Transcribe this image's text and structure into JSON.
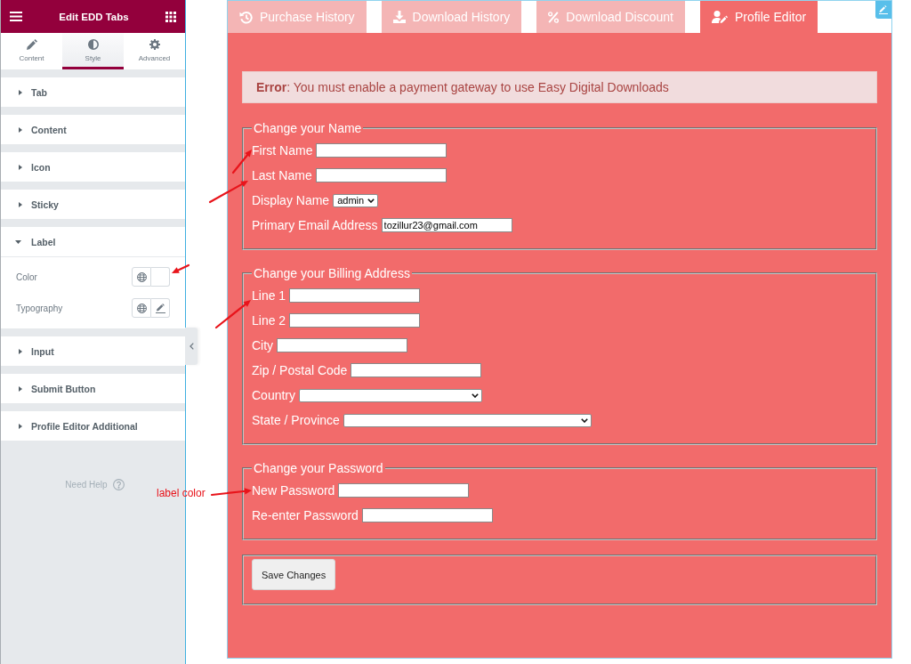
{
  "editor_panel": {
    "title": "Edit EDD Tabs",
    "tabs": [
      {
        "label": "Content",
        "selected": false
      },
      {
        "label": "Style",
        "selected": true
      },
      {
        "label": "Advanced",
        "selected": false
      }
    ],
    "sections": [
      {
        "title": "Tab",
        "expanded": false
      },
      {
        "title": "Content",
        "expanded": false
      },
      {
        "title": "Icon",
        "expanded": false
      },
      {
        "title": "Sticky",
        "expanded": false
      },
      {
        "title": "Label",
        "expanded": true,
        "controls": [
          {
            "label": "Color",
            "kind": "color"
          },
          {
            "label": "Typography",
            "kind": "typography"
          }
        ]
      },
      {
        "title": "Input",
        "expanded": false
      },
      {
        "title": "Submit Button",
        "expanded": false
      },
      {
        "title": "Profile Editor Additional",
        "expanded": false
      }
    ],
    "help_link": "Need Help"
  },
  "preview": {
    "tabs": [
      {
        "label": "Purchase History",
        "selected": false
      },
      {
        "label": "Download History",
        "selected": false
      },
      {
        "label": "Download Discount",
        "selected": false
      },
      {
        "label": "Profile Editor",
        "selected": true
      }
    ],
    "notice": "**Error**: You must enable a payment gateway to use Easy Digital Downloads",
    "fieldsets": [
      {
        "legend": "Change your Name",
        "fields": [
          {
            "label": "First Name",
            "kind": "text"
          },
          {
            "label": "Last Name",
            "kind": "text"
          },
          {
            "label": "Display Name",
            "kind": "select",
            "value": "admin"
          },
          {
            "label": "Primary Email Address",
            "kind": "text",
            "value": "tozillur23@gmail.com"
          }
        ]
      },
      {
        "legend": "Change your Billing Address",
        "fields": [
          {
            "label": "Line 1",
            "kind": "text"
          },
          {
            "label": "Line 2",
            "kind": "text"
          },
          {
            "label": "City",
            "kind": "text"
          },
          {
            "label": "Zip / Postal Code",
            "kind": "text"
          },
          {
            "label": "Country",
            "kind": "select"
          },
          {
            "label": "State / Province",
            "kind": "select"
          }
        ]
      },
      {
        "legend": "Change your Password",
        "fields": [
          {
            "label": "New Password",
            "kind": "text"
          },
          {
            "label": "Re-enter Password",
            "kind": "text"
          }
        ]
      }
    ],
    "submit_button": "Save Changes"
  },
  "annotations": [
    {
      "text": "label color"
    }
  ]
}
